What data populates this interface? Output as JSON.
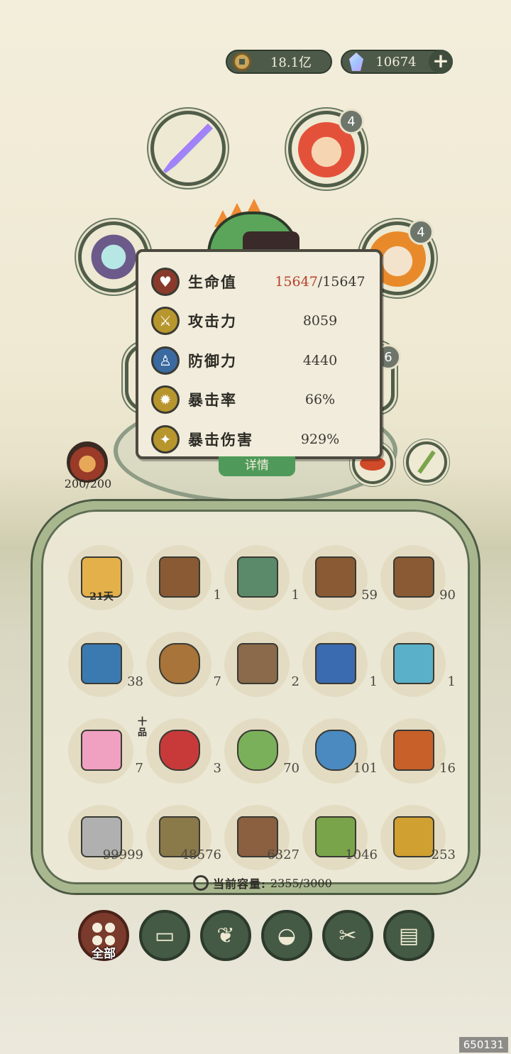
{
  "currency": {
    "copper": "18.1亿",
    "gems": "10674",
    "add_label": "+"
  },
  "equipment": {
    "helmet_slot_badge": "4",
    "ring_slot_badge": "4",
    "partial_badge": "6"
  },
  "stats": {
    "hp_label": "生命值",
    "hp_current": "15647",
    "hp_max": "/15647",
    "atk_label": "攻击力",
    "atk_value": "8059",
    "def_label": "防御力",
    "def_value": "4440",
    "crit_rate_label": "暴击率",
    "crit_rate_value": "66%",
    "crit_dmg_label": "暴击伤害",
    "crit_dmg_value": "929%"
  },
  "detail_button": "详情",
  "stamina": "200/200",
  "bag": {
    "items": [
      {
        "name": "scroll-item",
        "count": "",
        "tag": "21天",
        "grade": ""
      },
      {
        "name": "chest-item",
        "count": "1",
        "tag": "",
        "grade": ""
      },
      {
        "name": "chest-green-item",
        "count": "1",
        "tag": "",
        "grade": ""
      },
      {
        "name": "chest-item",
        "count": "59",
        "tag": "",
        "grade": ""
      },
      {
        "name": "chest-item",
        "count": "90",
        "tag": "",
        "grade": ""
      },
      {
        "name": "blue-chest-item",
        "count": "38",
        "tag": "",
        "grade": ""
      },
      {
        "name": "cloth-bag-item",
        "count": "7",
        "tag": "",
        "grade": ""
      },
      {
        "name": "plate-item",
        "count": "2",
        "tag": "",
        "grade": ""
      },
      {
        "name": "blue-talisman-item",
        "count": "1",
        "tag": "",
        "grade": ""
      },
      {
        "name": "fish-item",
        "count": "1",
        "tag": "",
        "grade": ""
      },
      {
        "name": "lotus-item",
        "count": "7",
        "tag": "",
        "grade": ""
      },
      {
        "name": "berries-item",
        "count": "3",
        "tag": "",
        "grade": "十品"
      },
      {
        "name": "green-bag-item",
        "count": "70",
        "tag": "",
        "grade": ""
      },
      {
        "name": "blue-bag-item",
        "count": "101",
        "tag": "",
        "grade": ""
      },
      {
        "name": "token-item",
        "count": "16",
        "tag": "",
        "grade": ""
      },
      {
        "name": "stone-item",
        "count": "99999",
        "tag": "",
        "grade": ""
      },
      {
        "name": "grass-item",
        "count": "48576",
        "tag": "",
        "grade": ""
      },
      {
        "name": "wood-item",
        "count": "6327",
        "tag": "",
        "grade": ""
      },
      {
        "name": "bamboo-item",
        "count": "1046",
        "tag": "",
        "grade": ""
      },
      {
        "name": "herb-item",
        "count": "253",
        "tag": "",
        "grade": ""
      }
    ],
    "capacity_label": "当前容量:",
    "capacity_value": "2355/3000"
  },
  "tabs": {
    "all_label": "全部"
  },
  "watermark": "650131",
  "colors": {
    "panel_border": "#a9b78f",
    "tab_bg": "#445a44",
    "tab_active": "#7a3a2c",
    "hp_red": "#b8402e"
  }
}
